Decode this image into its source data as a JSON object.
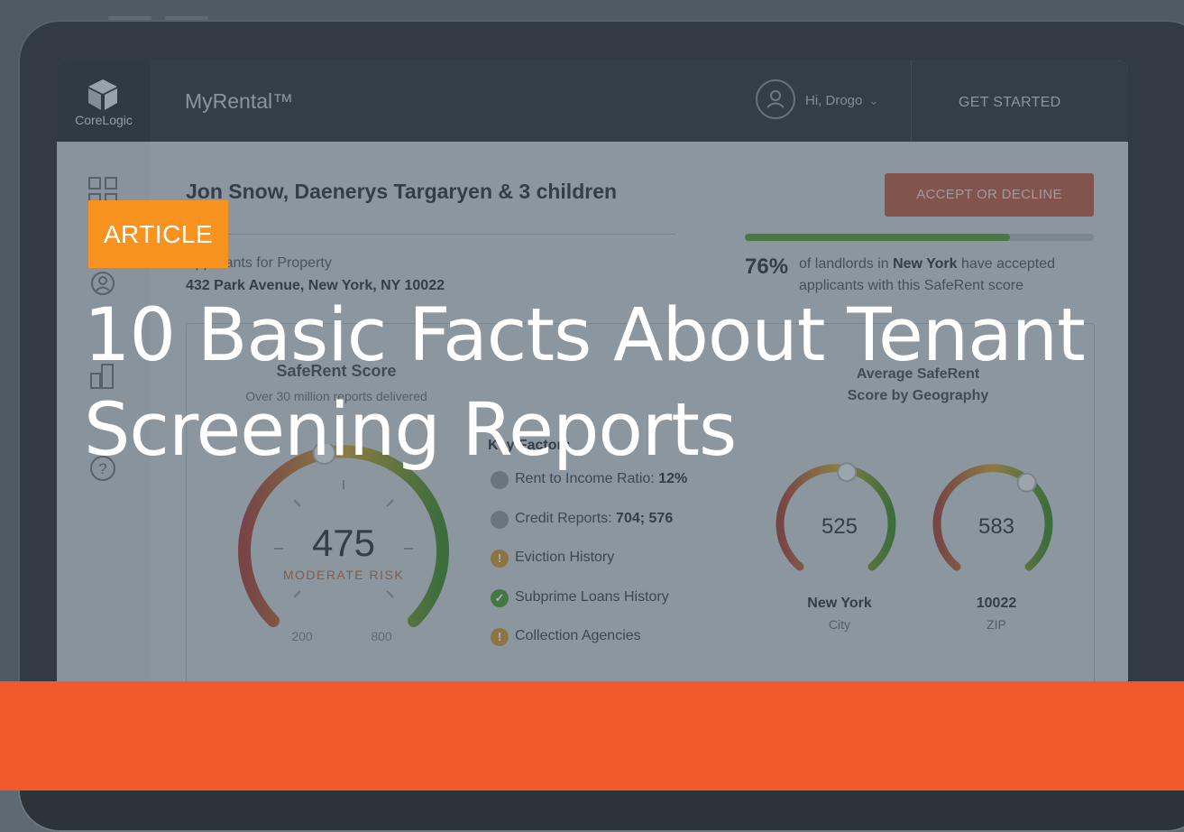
{
  "app": {
    "brand": "CoreLogic",
    "title": "MyRental™",
    "greeting": "Hi, Drogo",
    "get_started": "GET STARTED"
  },
  "applicants": {
    "names": "Jon Snow, Daenerys Targaryen & 3 children",
    "property_label": "Applicants for Property",
    "property_address": "432 Park Avenue, New York, NY 10022",
    "accept_button": "ACCEPT OR DECLINE"
  },
  "acceptance": {
    "percent_value": 76,
    "percent_label": "76%",
    "text_before": "of landlords in",
    "city": "New York",
    "text_after": "have accepted applicants with this SafeRent score"
  },
  "saferent": {
    "title": "SafeRent Score",
    "subtitle": "Over 30 million reports delivered",
    "score": "475",
    "risk_label": "MODERATE RISK",
    "min_label": "200",
    "max_label": "800",
    "score_value": 475,
    "min_value": 200,
    "max_value": 800
  },
  "key_factors": {
    "title": "Key Factors",
    "items": [
      {
        "label": "Rent to Income Ratio:",
        "value": "12%",
        "status": "neutral"
      },
      {
        "label": "Credit Reports:",
        "value": "704; 576",
        "status": "neutral"
      },
      {
        "label": "Eviction History",
        "value": "",
        "status": "warning"
      },
      {
        "label": "Subprime Loans History",
        "value": "",
        "status": "ok"
      },
      {
        "label": "Collection Agencies",
        "value": "",
        "status": "warning"
      }
    ]
  },
  "geography": {
    "title_line1": "Average SafeRent",
    "title_line2": "Score by Geography",
    "items": [
      {
        "score": "525",
        "name": "New York",
        "type": "City",
        "value": 525
      },
      {
        "score": "583",
        "name": "10022",
        "type": "ZIP",
        "value": 583
      }
    ]
  },
  "overlay": {
    "badge": "ARTICLE",
    "headline_line1": "10 Basic Facts About Tenant",
    "headline_line2": "Screening Reports"
  },
  "colors": {
    "accent_orange": "#f7931e",
    "bottom_bar": "#f15a2b",
    "accept_button": "#d9664a",
    "progress_green": "#5a9a3c"
  }
}
